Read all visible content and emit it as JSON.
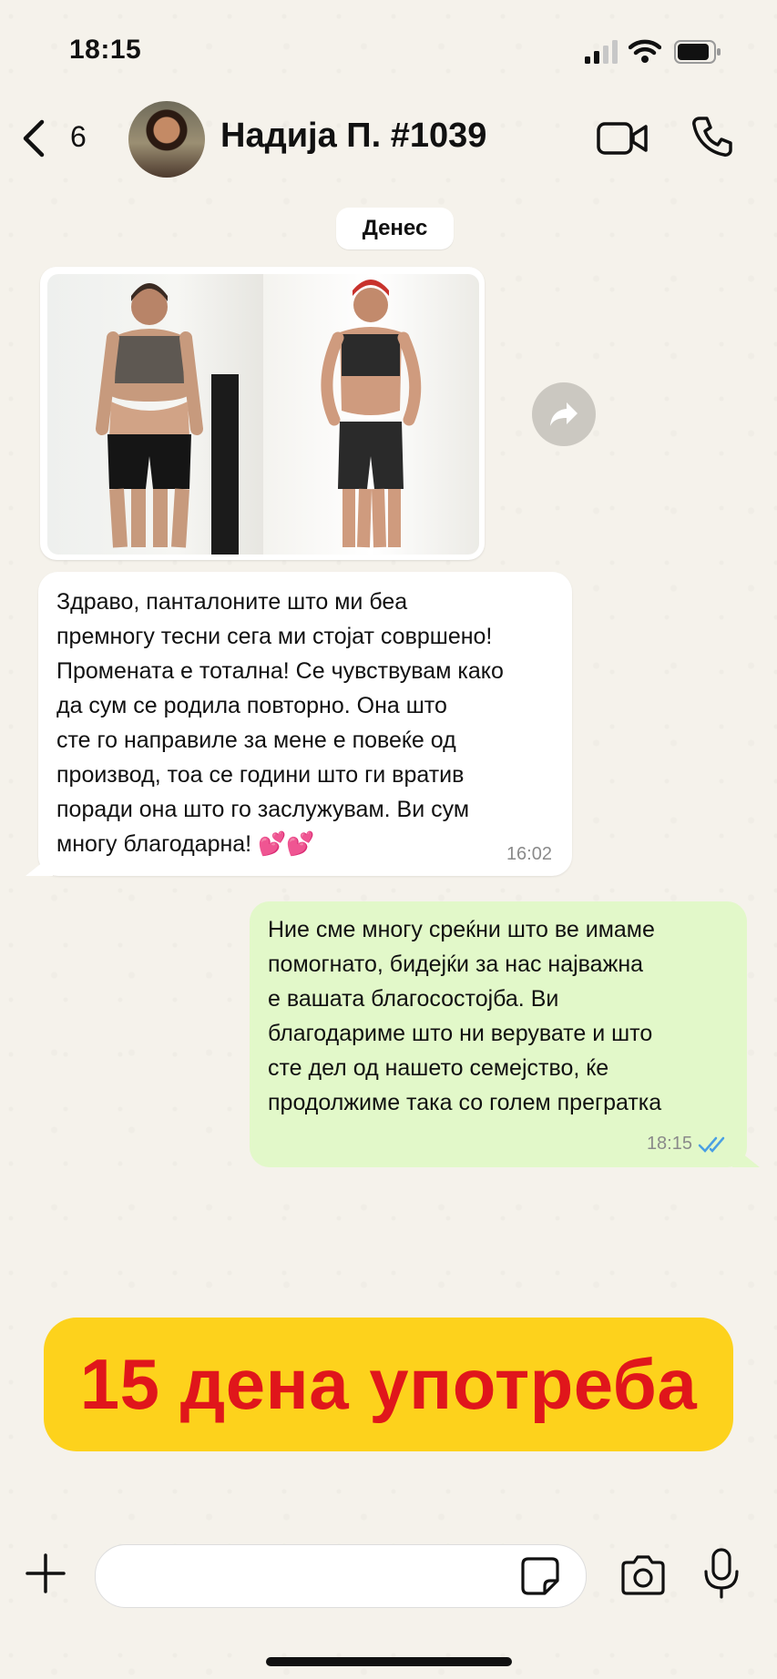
{
  "status_bar": {
    "time": "18:15"
  },
  "header": {
    "back_count": "6",
    "contact_name": "Надија П. #1039"
  },
  "chat": {
    "date_label": "Денес",
    "incoming": {
      "text": "Здраво, панталоните што ми беа\nпремногу тесни сега ми стојат совршено!\nПромената е тотална! Се чувствувам како\nда сум се родила повторно. Она што\nсте го направиле за мене е повеќе од\nпроизвод, тоа се години што ги вратив\nпоради она што го заслужувам. Ви сум\nмногу благодарна! 💕💕",
      "time": "16:02"
    },
    "outgoing": {
      "text": "Ние сме многу среќни што ве имаме\nпомогнато, бидејќи за нас најважна\nе вашата благосостојба. Ви\nблагодариме што ни верувате и што\nсте дел од нашето семејство, ќе\nпродолжиме така со голем прегратка",
      "time": "18:15"
    }
  },
  "promo": {
    "text": "15 дена употреба"
  },
  "colors": {
    "outgoing_bubble": "#e2f8c9",
    "promo_bg": "#fdd21c",
    "promo_text": "#e0161b",
    "read_ticks": "#4a9fe3"
  },
  "icons": [
    "back-icon",
    "video-camera-icon",
    "phone-icon",
    "forward-icon",
    "plus-icon",
    "sticker-icon",
    "camera-icon",
    "microphone-icon",
    "read-ticks-icon"
  ]
}
